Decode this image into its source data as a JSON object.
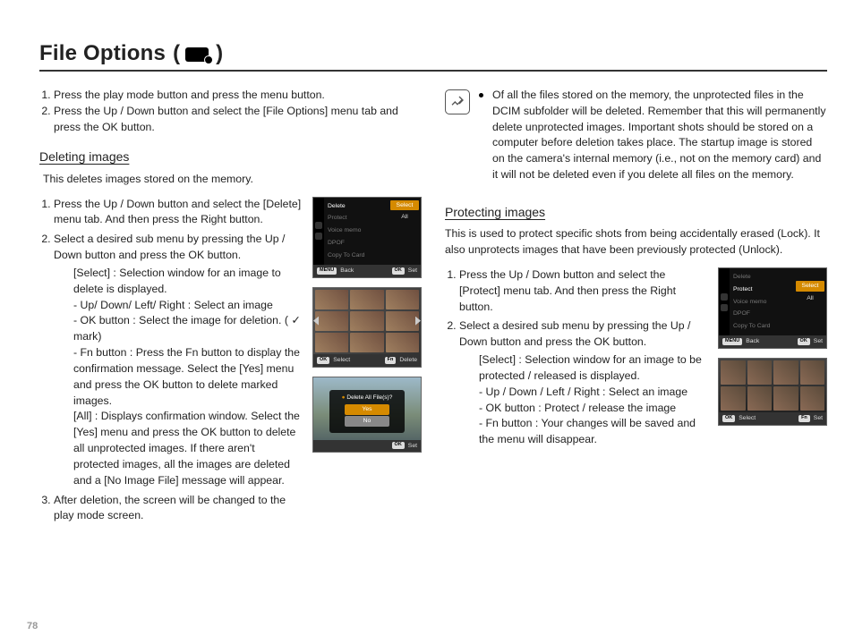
{
  "page_number": "78",
  "title": "File Options",
  "intro_steps": [
    "Press the play mode button and press the menu button.",
    "Press the Up / Down button and select the [File Options] menu tab and press the OK button."
  ],
  "deleting": {
    "heading": "Deleting images",
    "blurb": "This deletes images stored on the memory.",
    "step1": "Press the Up / Down button and select the [Delete] menu tab. And then press the Right button.",
    "step2": "Select a desired sub menu by pressing the Up / Down button and press the OK button.",
    "select_label": "[Select] : Selection window for an image to delete is displayed.",
    "nav_line": "- Up/ Down/ Left/ Right : Select an image",
    "ok_line": "- OK button : Select the image for deletion. ( ✓ mark)",
    "fn_line": "- Fn button : Press the Fn button to display the confirmation message. Select the [Yes] menu and press the OK button to delete marked images.",
    "all_line": "[All] : Displays confirmation window. Select the [Yes] menu and press the OK button to delete all unprotected images. If there aren't protected images, all the images are deleted and a [No Image File] message will appear.",
    "step3": "After deletion, the screen will be changed to the play mode screen."
  },
  "note": "Of all the files stored on the memory, the unprotected files in the DCIM subfolder will be deleted. Remember that this will permanently delete unprotected images. Important shots should be stored on a computer before deletion takes place. The startup image is stored on the camera's internal memory (i.e., not on the memory card) and it will not be deleted even if you delete all files on the memory.",
  "protecting": {
    "heading": "Protecting images",
    "blurb": "This is used to protect specific shots from being accidentally erased (Lock). It also unprotects images that have been previously protected (Unlock).",
    "step1": "Press the Up / Down button and select the [Protect] menu tab. And then press the Right button.",
    "step2": "Select a desired sub menu by pressing the Up / Down button and press the OK button.",
    "select_label": "[Select] : Selection window for an image to be protected / released is displayed.",
    "nav_line": "- Up / Down / Left / Right : Select an image",
    "ok_line": "- OK button : Protect / release the image",
    "fn_line": "- Fn button : Your changes will be saved and the menu will disappear."
  },
  "cam": {
    "menu_items": [
      "Delete",
      "Protect",
      "Voice memo",
      "DPOF",
      "Copy To Card"
    ],
    "submenu": {
      "select": "Select",
      "all": "All"
    },
    "foot": {
      "menu": "MENU",
      "back": "Back",
      "ok": "OK",
      "set": "Set",
      "fn": "Fn",
      "select": "Select",
      "delete": "Delete"
    },
    "dialog": {
      "question": "Delete All File(s)?",
      "yes": "Yes",
      "no": "No"
    }
  }
}
